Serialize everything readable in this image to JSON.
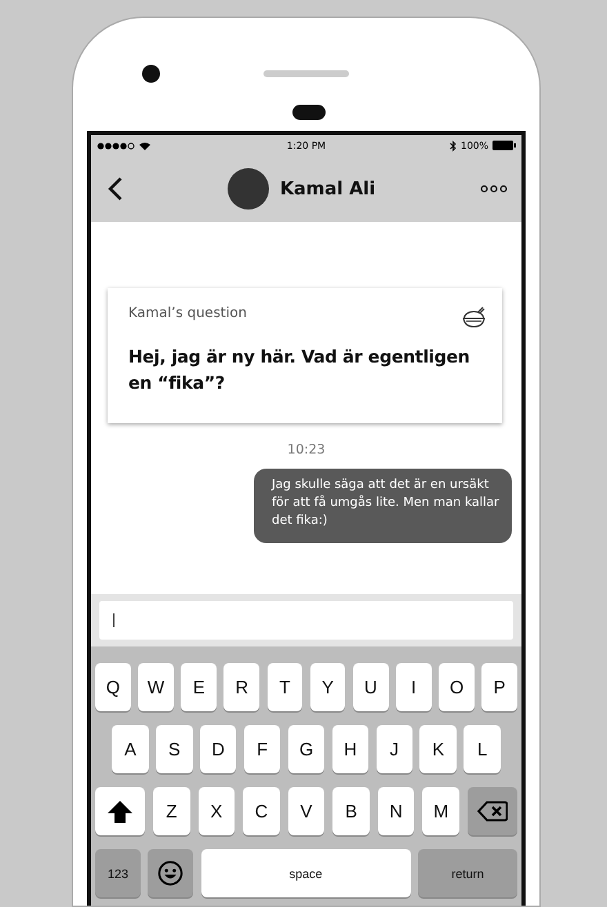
{
  "status_bar": {
    "time": "1:20 PM",
    "battery": "100%"
  },
  "header": {
    "contact_name": "Kamal Ali"
  },
  "question_card": {
    "label": "Kamal’s question",
    "text": "Hej, jag är ny här. Vad är egentligen en “fika”?"
  },
  "timestamp": "10:23",
  "messages": [
    {
      "kind": "sent",
      "text": "Jag skulle säga att det är en ursäkt för att få umgås lite. Men man kallar det fika:)"
    }
  ],
  "keyboard": {
    "letter_rows": [
      [
        {
          "kind": "letter",
          "label": "Q"
        },
        {
          "kind": "letter",
          "label": "W"
        },
        {
          "kind": "letter",
          "label": "E"
        },
        {
          "kind": "letter",
          "label": "R"
        },
        {
          "kind": "letter",
          "label": "T"
        },
        {
          "kind": "letter",
          "label": "Y"
        },
        {
          "kind": "letter",
          "label": "U"
        },
        {
          "kind": "letter",
          "label": "I"
        },
        {
          "kind": "letter",
          "label": "O"
        },
        {
          "kind": "letter",
          "label": "P"
        }
      ],
      [
        {
          "kind": "letter",
          "label": "A"
        },
        {
          "kind": "letter",
          "label": "S"
        },
        {
          "kind": "letter",
          "label": "D"
        },
        {
          "kind": "letter",
          "label": "F"
        },
        {
          "kind": "letter",
          "label": "G"
        },
        {
          "kind": "letter",
          "label": "H"
        },
        {
          "kind": "letter",
          "label": "J"
        },
        {
          "kind": "letter",
          "label": "K"
        },
        {
          "kind": "letter",
          "label": "L"
        }
      ],
      [
        {
          "kind": "shift"
        },
        {
          "kind": "letter",
          "label": "Z"
        },
        {
          "kind": "letter",
          "label": "X"
        },
        {
          "kind": "letter",
          "label": "C"
        },
        {
          "kind": "letter",
          "label": "V"
        },
        {
          "kind": "letter",
          "label": "B"
        },
        {
          "kind": "letter",
          "label": "N"
        },
        {
          "kind": "letter",
          "label": "M"
        },
        {
          "kind": "delete"
        }
      ]
    ],
    "bottom_keys": [
      {
        "kind": "mode",
        "label": "123"
      },
      {
        "kind": "emoji"
      },
      {
        "kind": "space",
        "label": "space"
      },
      {
        "kind": "return",
        "label": "return"
      }
    ]
  }
}
